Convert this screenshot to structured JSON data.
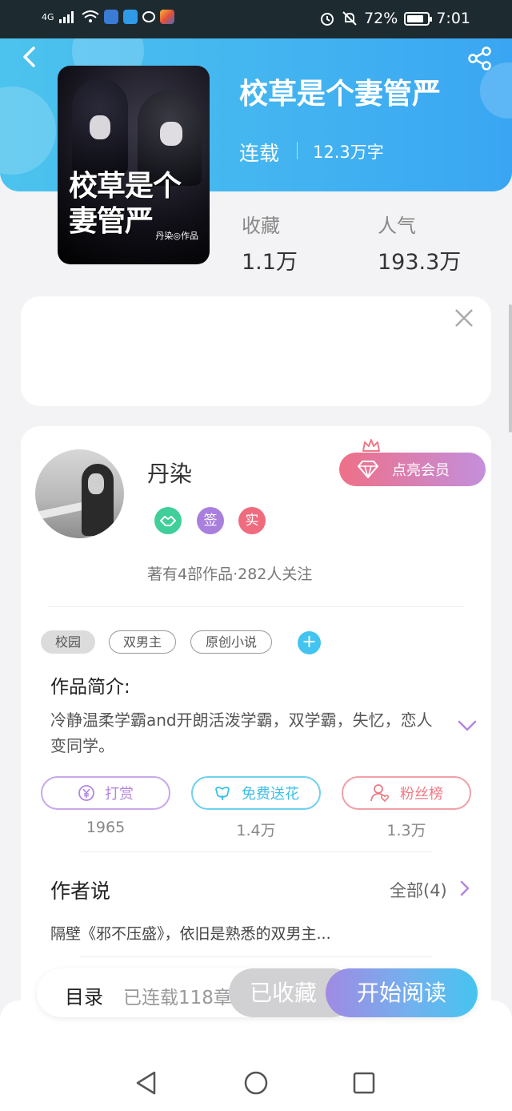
{
  "status_bar": {
    "network": "4G",
    "battery": "72%",
    "time": "7:01",
    "battery_level": 0.72
  },
  "header": {
    "back_icon": "chevron-left-icon",
    "share_icon": "share-icon"
  },
  "book": {
    "title": "校草是个妻管严",
    "status": "连载",
    "word_count": "12.3万字",
    "cover_title": "校草是个妻管严",
    "cover_author": "丹染◎作品",
    "stats": [
      {
        "label": "收藏",
        "value": "1.1万"
      },
      {
        "label": "人气",
        "value": "193.3万"
      }
    ]
  },
  "ad": {
    "close_icon": "close-icon"
  },
  "author": {
    "name": "丹染",
    "vip_button": "点亮会员",
    "badges": [
      {
        "label": "",
        "icon": "handshake-icon",
        "color": "#3fcf9a"
      },
      {
        "label": "签",
        "icon": "",
        "color": "#a97fde"
      },
      {
        "label": "实",
        "icon": "",
        "color": "#f06b7d"
      }
    ],
    "stats": "著有4部作品·282人关注"
  },
  "tags": [
    "校园",
    "双男主",
    "原创小说"
  ],
  "intro": {
    "heading": "作品简介:",
    "text": "冷静温柔学霸and开朗活泼学霸，双学霸，失忆，恋人变同学。"
  },
  "actions": [
    {
      "label": "打赏",
      "count": "1965",
      "icon": "yen-icon",
      "color": "#b386df"
    },
    {
      "label": "免费送花",
      "count": "1.4万",
      "icon": "flower-icon",
      "color": "#3cbfe8"
    },
    {
      "label": "粉丝榜",
      "count": "1.3万",
      "icon": "fan-icon",
      "color": "#ef7a86"
    }
  ],
  "author_says": {
    "heading": "作者说",
    "all_label": "全部(4)",
    "text": "隔壁《邪不压盛》，依旧是熟悉的双男主..."
  },
  "bottom_bar": {
    "toc_label": "目录",
    "toc_count": "已连载118章",
    "collected_label": "已收藏",
    "read_label": "开始阅读"
  },
  "nav": {
    "back": "triangle-back-icon",
    "home": "circle-home-icon",
    "recent": "square-recent-icon"
  }
}
